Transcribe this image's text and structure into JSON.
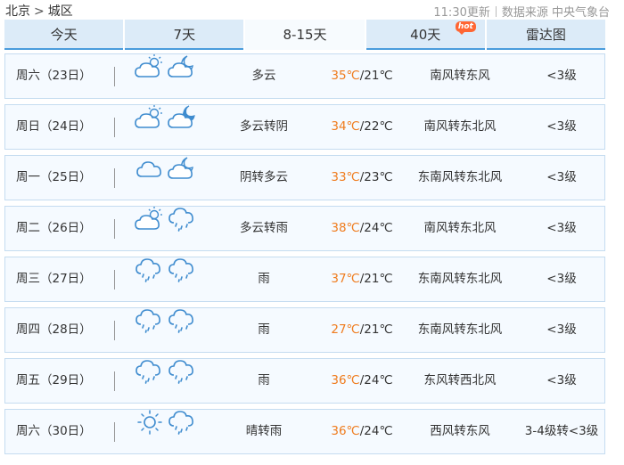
{
  "breadcrumb": {
    "city": "北京",
    "separator": ">",
    "district": "城区"
  },
  "meta": {
    "update_time": "11:30更新",
    "source": "数据来源 中央气象台"
  },
  "tabs": [
    {
      "label": "今天",
      "active": false
    },
    {
      "label": "7天",
      "active": false
    },
    {
      "label": "8-15天",
      "active": true
    },
    {
      "label": "40天",
      "active": false,
      "badge": "hot"
    },
    {
      "label": "雷达图",
      "active": false
    }
  ],
  "colors": {
    "accent": "#4a9cdc",
    "tab_bg": "#dcebf8",
    "row_bg": "#f5faff",
    "high_temp": "#ef7c1e",
    "hot_badge": "#ff6633"
  },
  "forecast": [
    {
      "day": "周六（23日）",
      "icons": [
        "partly-cloudy-day-icon",
        "partly-cloudy-night-icon"
      ],
      "desc": "多云",
      "high": "35℃",
      "low": "/21℃",
      "wind": "南风转东风",
      "level": "<3级"
    },
    {
      "day": "周日（24日）",
      "icons": [
        "partly-cloudy-day-icon",
        "cloudy-moon-icon"
      ],
      "desc": "多云转阴",
      "high": "34℃",
      "low": "/22℃",
      "wind": "南风转东北风",
      "level": "<3级"
    },
    {
      "day": "周一（25日）",
      "icons": [
        "cloudy-icon",
        "partly-cloudy-night-icon"
      ],
      "desc": "阴转多云",
      "high": "33℃",
      "low": "/23℃",
      "wind": "东南风转东北风",
      "level": "<3级"
    },
    {
      "day": "周二（26日）",
      "icons": [
        "partly-cloudy-day-icon",
        "rain-icon"
      ],
      "desc": "多云转雨",
      "high": "38℃",
      "low": "/24℃",
      "wind": "南风转东北风",
      "level": "<3级"
    },
    {
      "day": "周三（27日）",
      "icons": [
        "rain-icon",
        "rain-icon"
      ],
      "desc": "雨",
      "high": "37℃",
      "low": "/21℃",
      "wind": "东南风转东北风",
      "level": "<3级"
    },
    {
      "day": "周四（28日）",
      "icons": [
        "rain-icon",
        "rain-icon"
      ],
      "desc": "雨",
      "high": "27℃",
      "low": "/21℃",
      "wind": "东南风转东北风",
      "level": "<3级"
    },
    {
      "day": "周五（29日）",
      "icons": [
        "rain-icon",
        "rain-icon"
      ],
      "desc": "雨",
      "high": "36℃",
      "low": "/24℃",
      "wind": "东风转西北风",
      "level": "<3级"
    },
    {
      "day": "周六（30日）",
      "icons": [
        "sunny-icon",
        "rain-icon"
      ],
      "desc": "晴转雨",
      "high": "36℃",
      "low": "/24℃",
      "wind": "西风转东风",
      "level": "3-4级转<3级"
    }
  ]
}
